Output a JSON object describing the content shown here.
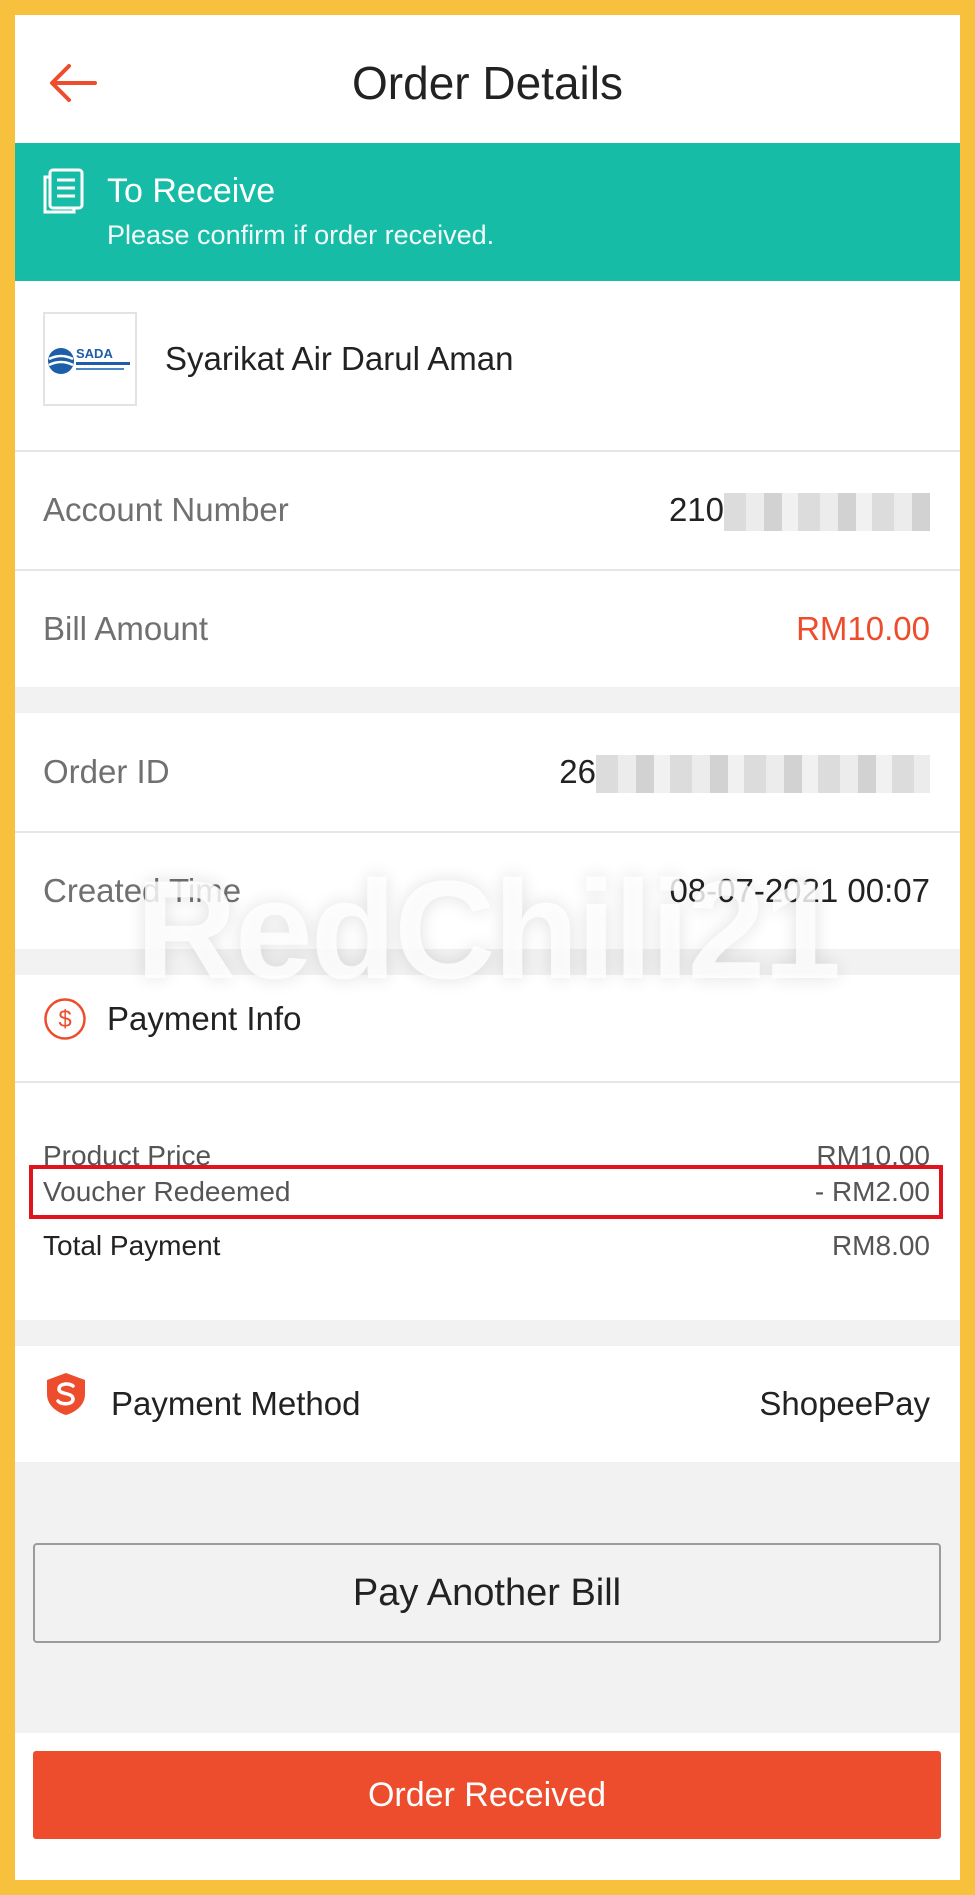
{
  "header": {
    "title": "Order Details"
  },
  "status": {
    "title": "To Receive",
    "subtitle": "Please confirm if order received."
  },
  "biller": {
    "name": "Syarikat Air Darul Aman",
    "logo_text": "SADA"
  },
  "details": {
    "account_number": {
      "label": "Account Number",
      "value_visible": "210"
    },
    "bill_amount": {
      "label": "Bill Amount",
      "value": "RM10.00"
    },
    "order_id": {
      "label": "Order ID",
      "value_visible": "26"
    },
    "created_time": {
      "label": "Created Time",
      "value": "08-07-2021 00:07"
    }
  },
  "payment_info": {
    "title": "Payment Info",
    "product_price": {
      "label": "Product Price",
      "value": "RM10.00"
    },
    "voucher": {
      "label": "Voucher Redeemed",
      "value": "- RM2.00"
    },
    "total": {
      "label": "Total Payment",
      "value": "RM8.00"
    }
  },
  "payment_method": {
    "label": "Payment Method",
    "value": "ShopeePay"
  },
  "buttons": {
    "pay_another": "Pay Another Bill",
    "order_received": "Order Received"
  },
  "watermark": "RedChili21",
  "colors": {
    "accent": "#ee4d2d",
    "banner": "#17bca7",
    "highlight": "#e0141e",
    "border": "#f8c13d"
  }
}
